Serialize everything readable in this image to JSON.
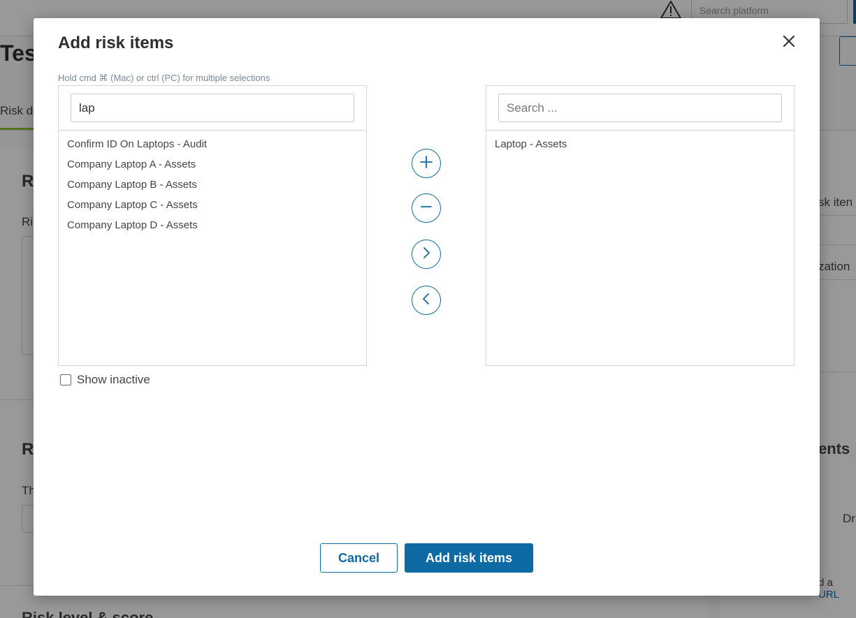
{
  "background": {
    "search_placeholder": "Search platform",
    "page_title_fragment": "Tes",
    "tab_fragment": "Risk d",
    "section_letter_1": "R",
    "label_fragment_1": "Ri",
    "section_letter_2": "R",
    "label_fragment_2": "Th",
    "right_text_1": "sk iten",
    "right_text_2": "zation",
    "right_heading": "ents",
    "right_text_3": "Dr",
    "right_link_prefix": "d a ",
    "right_link": "URL",
    "footer_title": "Risk level & score"
  },
  "modal": {
    "title": "Add risk items",
    "hint": "Hold cmd ⌘ (Mac) or ctrl (PC) for multiple selections",
    "left": {
      "search_value": "lap",
      "items": [
        "Confirm ID On Laptops - Audit",
        "Company Laptop A - Assets",
        "Company Laptop B - Assets",
        "Company Laptop C - Assets",
        "Company Laptop D - Assets"
      ]
    },
    "right": {
      "search_placeholder": "Search ...",
      "items": [
        "Laptop - Assets"
      ]
    },
    "show_inactive_label": "Show inactive",
    "cancel_label": "Cancel",
    "submit_label": "Add risk items"
  },
  "colors": {
    "accent": "#0e6aa3",
    "tab_underline": "#8fbf3f"
  }
}
